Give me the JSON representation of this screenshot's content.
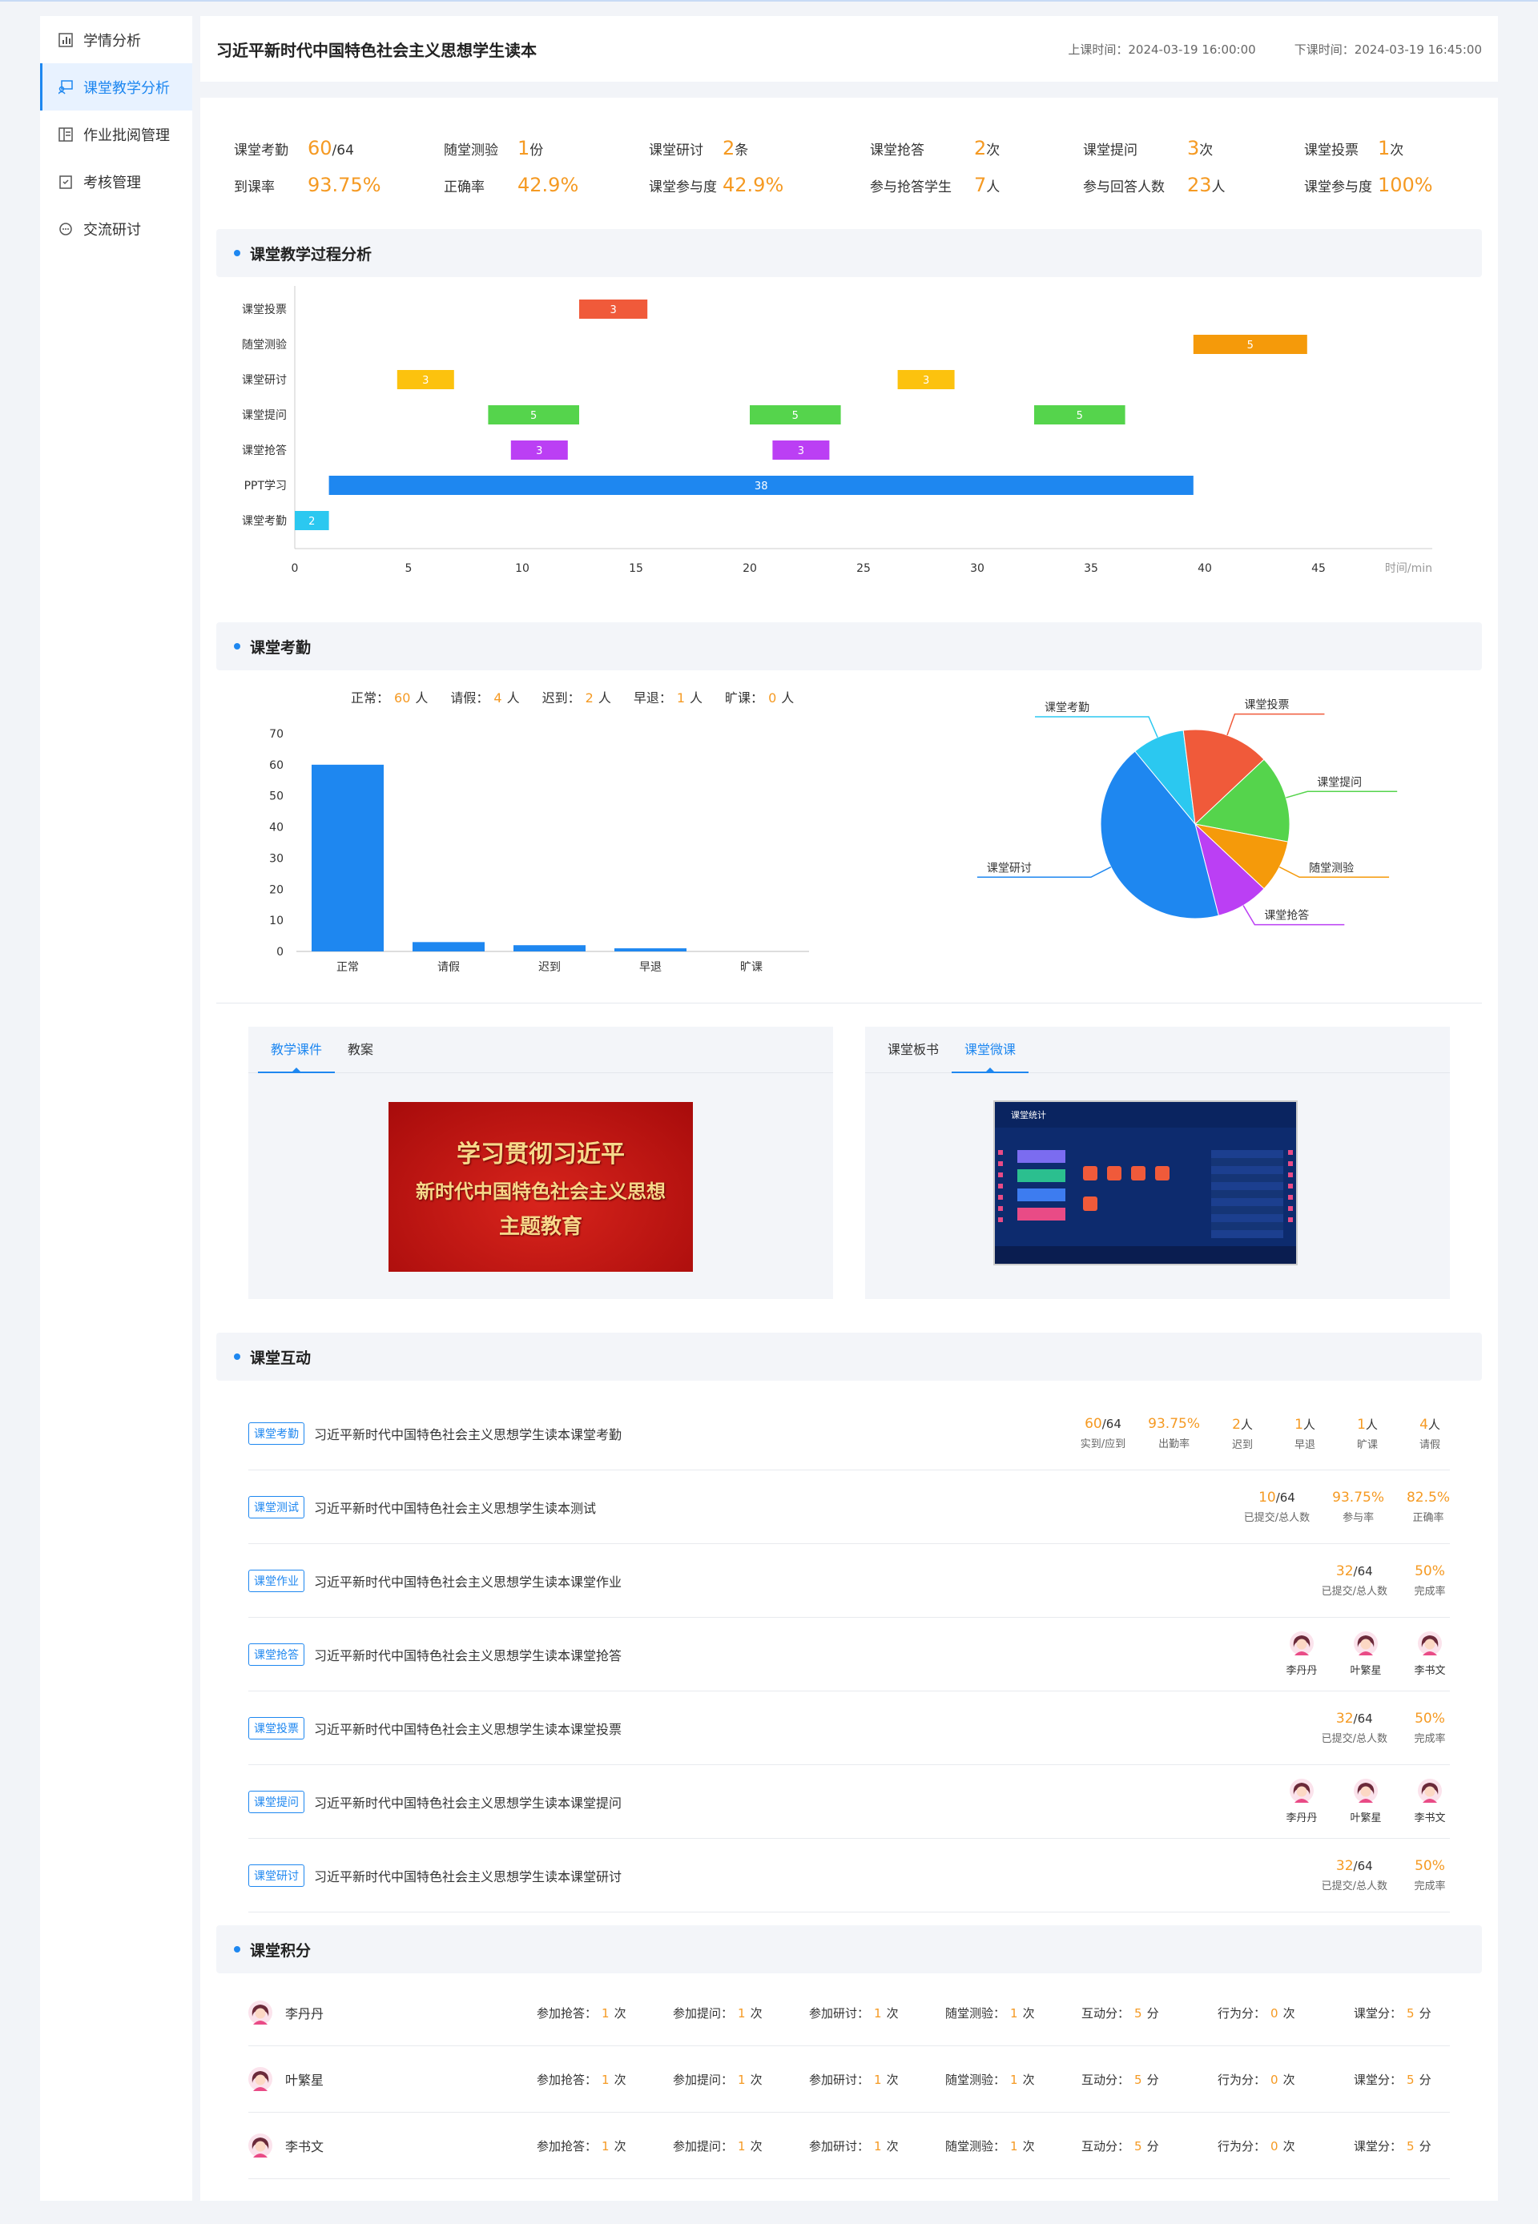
{
  "sidebar": {
    "items": [
      {
        "label": "学情分析",
        "icon": "bar-chart-icon"
      },
      {
        "label": "课堂教学分析",
        "icon": "classroom-icon"
      },
      {
        "label": "作业批阅管理",
        "icon": "document-icon"
      },
      {
        "label": "考核管理",
        "icon": "clipboard-check-icon"
      },
      {
        "label": "交流研讨",
        "icon": "chat-icon"
      }
    ]
  },
  "header": {
    "title": "习近平新时代中国特色社会主义思想学生读本",
    "start": "上课时间：2024-03-19 16:00:00",
    "end": "下课时间：2024-03-19 16:45:00"
  },
  "stats": {
    "row1": [
      {
        "label": "课堂考勤",
        "value": "60",
        "suffix": "/64"
      },
      {
        "label": "随堂测验",
        "value": "1",
        "suffix": "份"
      },
      {
        "label": "课堂研讨",
        "value": "2",
        "suffix": "条"
      },
      {
        "label": "课堂抢答",
        "value": "2",
        "suffix": "次"
      },
      {
        "label": "课堂提问",
        "value": "3",
        "suffix": "次"
      },
      {
        "label": "课堂投票",
        "value": "1",
        "suffix": "次"
      }
    ],
    "row2": [
      {
        "label": "到课率",
        "value": "93.75%",
        "suffix": ""
      },
      {
        "label": "正确率",
        "value": "42.9%",
        "suffix": ""
      },
      {
        "label": "课堂参与度",
        "value": "42.9%",
        "suffix": ""
      },
      {
        "label": "参与抢答学生",
        "value": "7",
        "suffix": "人"
      },
      {
        "label": "参与回答人数",
        "value": "23",
        "suffix": "人"
      },
      {
        "label": "课堂参与度",
        "value": "100%",
        "suffix": ""
      }
    ]
  },
  "sections": {
    "process": "课堂教学过程分析",
    "attendance": "课堂考勤",
    "interaction": "课堂互动",
    "score": "课堂积分"
  },
  "process_chart": {
    "type": "gantt",
    "rows": [
      "课堂投票",
      "随堂测验",
      "课堂研讨",
      "课堂提问",
      "课堂抢答",
      "PPT学习",
      "课堂考勤"
    ],
    "xticks": [
      0,
      5,
      10,
      15,
      20,
      25,
      30,
      35,
      40,
      45
    ],
    "xunit": "时间/min",
    "xlim": [
      0,
      50
    ],
    "bars": [
      {
        "row": 0,
        "start": 12.5,
        "end": 15.5,
        "label": "3",
        "color": "#f05a3a"
      },
      {
        "row": 1,
        "start": 39.5,
        "end": 44.5,
        "label": "5",
        "color": "#f59a0a"
      },
      {
        "row": 2,
        "start": 4.5,
        "end": 7,
        "label": "3",
        "color": "#fcc20e"
      },
      {
        "row": 2,
        "start": 26.5,
        "end": 29,
        "label": "3",
        "color": "#fcc20e"
      },
      {
        "row": 3,
        "start": 8.5,
        "end": 12.5,
        "label": "5",
        "color": "#55d44c"
      },
      {
        "row": 3,
        "start": 20,
        "end": 24,
        "label": "5",
        "color": "#55d44c"
      },
      {
        "row": 3,
        "start": 32.5,
        "end": 36.5,
        "label": "5",
        "color": "#55d44c"
      },
      {
        "row": 4,
        "start": 9.5,
        "end": 12,
        "label": "3",
        "color": "#bb3ff4"
      },
      {
        "row": 4,
        "start": 21,
        "end": 23.5,
        "label": "3",
        "color": "#bb3ff4"
      },
      {
        "row": 5,
        "start": 1.5,
        "end": 39.5,
        "label": "38",
        "color": "#1e87f0"
      },
      {
        "row": 6,
        "start": 0,
        "end": 1.5,
        "label": "2",
        "color": "#2bc8f0"
      }
    ]
  },
  "attendance_summary": [
    {
      "label": "正常：",
      "value": "60",
      "unit": "人"
    },
    {
      "label": "请假：",
      "value": "4",
      "unit": "人"
    },
    {
      "label": "迟到：",
      "value": "2",
      "unit": "人"
    },
    {
      "label": "早退：",
      "value": "1",
      "unit": "人"
    },
    {
      "label": "旷课：",
      "value": "0",
      "unit": "人"
    }
  ],
  "chart_data": [
    {
      "type": "bar",
      "categories": [
        "正常",
        "请假",
        "迟到",
        "早退",
        "旷课"
      ],
      "values": [
        60,
        3,
        2,
        1,
        0
      ],
      "ylim": [
        0,
        70
      ],
      "yticks": [
        0,
        10,
        20,
        30,
        40,
        50,
        60,
        70
      ],
      "color": "#1e87f0",
      "grid": false
    },
    {
      "type": "pie",
      "slices": [
        {
          "name": "课堂考勤",
          "value": 9,
          "color": "#2bc8f0"
        },
        {
          "name": "课堂投票",
          "value": 15,
          "color": "#f05a3a"
        },
        {
          "name": "课堂提问",
          "value": 15,
          "color": "#55d44c"
        },
        {
          "name": "随堂测验",
          "value": 9,
          "color": "#f59a0a"
        },
        {
          "name": "课堂抢答",
          "value": 9,
          "color": "#bb3ff4"
        },
        {
          "name": "课堂研讨",
          "value": 43,
          "color": "#1e87f0"
        }
      ]
    }
  ],
  "media": {
    "left_tabs": [
      "教学课件",
      "教案"
    ],
    "right_tabs": [
      "课堂板书",
      "课堂微课"
    ],
    "slide_lines": [
      "学习贯彻习近平",
      "新时代中国特色社会主义思想",
      "主题教育"
    ],
    "screen_title": "课堂统计"
  },
  "interactions": [
    {
      "tag": "课堂考勤",
      "title": "习近平新时代中国特色社会主义思想学生读本课堂考勤",
      "metrics": [
        {
          "v": "60",
          "t": "/64",
          "k": "实到/应到"
        },
        {
          "v": "93.75%",
          "t": "",
          "k": "出勤率"
        },
        {
          "v": "2",
          "t": "人",
          "k": "迟到"
        },
        {
          "v": "1",
          "t": "人",
          "k": "早退"
        },
        {
          "v": "1",
          "t": "人",
          "k": "旷课"
        },
        {
          "v": "4",
          "t": "人",
          "k": "请假"
        }
      ]
    },
    {
      "tag": "课堂测试",
      "title": "习近平新时代中国特色社会主义思想学生读本测试",
      "metrics": [
        {
          "v": "10",
          "t": "/64",
          "k": "已提交/总人数"
        },
        {
          "v": "93.75%",
          "t": "",
          "k": "参与率"
        },
        {
          "v": "82.5%",
          "t": "",
          "k": "正确率"
        }
      ]
    },
    {
      "tag": "课堂作业",
      "title": "习近平新时代中国特色社会主义思想学生读本课堂作业",
      "metrics": [
        {
          "v": "32",
          "t": "/64",
          "k": "已提交/总人数"
        },
        {
          "v": "50%",
          "t": "",
          "k": "完成率"
        }
      ]
    },
    {
      "tag": "课堂抢答",
      "title": "习近平新时代中国特色社会主义思想学生读本课堂抢答",
      "people": [
        "李丹丹",
        "叶繁星",
        "李书文"
      ]
    },
    {
      "tag": "课堂投票",
      "title": "习近平新时代中国特色社会主义思想学生读本课堂投票",
      "metrics": [
        {
          "v": "32",
          "t": "/64",
          "k": "已提交/总人数"
        },
        {
          "v": "50%",
          "t": "",
          "k": "完成率"
        }
      ]
    },
    {
      "tag": "课堂提问",
      "title": "习近平新时代中国特色社会主义思想学生读本课堂提问",
      "people": [
        "李丹丹",
        "叶繁星",
        "李书文"
      ]
    },
    {
      "tag": "课堂研讨",
      "title": "习近平新时代中国特色社会主义思想学生读本课堂研讨",
      "metrics": [
        {
          "v": "32",
          "t": "/64",
          "k": "已提交/总人数"
        },
        {
          "v": "50%",
          "t": "",
          "k": "完成率"
        }
      ]
    }
  ],
  "scores": [
    {
      "name": "李丹丹",
      "items": [
        {
          "l": "参加抢答：",
          "v": "1",
          "u": "次"
        },
        {
          "l": "参加提问：",
          "v": "1",
          "u": "次"
        },
        {
          "l": "参加研讨：",
          "v": "1",
          "u": "次"
        },
        {
          "l": "随堂测验：",
          "v": "1",
          "u": "次"
        },
        {
          "l": "互动分：",
          "v": "5",
          "u": "分"
        },
        {
          "l": "行为分：",
          "v": "0",
          "u": "次"
        },
        {
          "l": "课堂分：",
          "v": "5",
          "u": "分"
        }
      ]
    },
    {
      "name": "叶繁星",
      "items": [
        {
          "l": "参加抢答：",
          "v": "1",
          "u": "次"
        },
        {
          "l": "参加提问：",
          "v": "1",
          "u": "次"
        },
        {
          "l": "参加研讨：",
          "v": "1",
          "u": "次"
        },
        {
          "l": "随堂测验：",
          "v": "1",
          "u": "次"
        },
        {
          "l": "互动分：",
          "v": "5",
          "u": "分"
        },
        {
          "l": "行为分：",
          "v": "0",
          "u": "次"
        },
        {
          "l": "课堂分：",
          "v": "5",
          "u": "分"
        }
      ]
    },
    {
      "name": "李书文",
      "items": [
        {
          "l": "参加抢答：",
          "v": "1",
          "u": "次"
        },
        {
          "l": "参加提问：",
          "v": "1",
          "u": "次"
        },
        {
          "l": "参加研讨：",
          "v": "1",
          "u": "次"
        },
        {
          "l": "随堂测验：",
          "v": "1",
          "u": "次"
        },
        {
          "l": "互动分：",
          "v": "5",
          "u": "分"
        },
        {
          "l": "行为分：",
          "v": "0",
          "u": "次"
        },
        {
          "l": "课堂分：",
          "v": "5",
          "u": "分"
        }
      ]
    }
  ]
}
